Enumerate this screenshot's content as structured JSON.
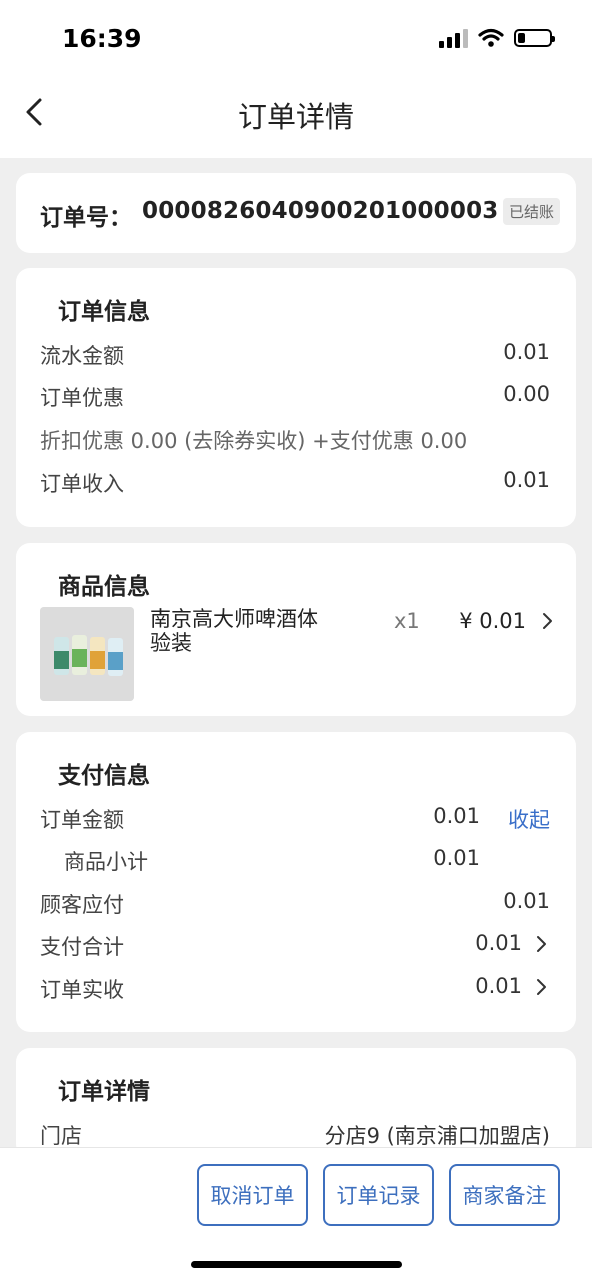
{
  "status_bar": {
    "time": "16:39"
  },
  "nav": {
    "title": "订单详情"
  },
  "order": {
    "label": "订单号：",
    "number": "0000826040900201000003",
    "status": "已结账"
  },
  "order_info": {
    "title": "订单信息",
    "flow_label": "流水金额",
    "flow_value": "0.01",
    "discount_label": "订单优惠",
    "discount_value": "0.00",
    "discount_detail": "折扣优惠 0.00 (去除券实收) +支付优惠 0.00",
    "income_label": "订单收入",
    "income_value": "0.01"
  },
  "product_info": {
    "title": "商品信息",
    "name": "南京高大师啤酒体验装",
    "qty": "x1",
    "price": "¥ 0.01"
  },
  "payment_info": {
    "title": "支付信息",
    "order_amount_label": "订单金额",
    "order_amount_value": "0.01",
    "collapse_label": "收起",
    "subtotal_label": "商品小计",
    "subtotal_value": "0.01",
    "customer_due_label": "顾客应付",
    "customer_due_value": "0.01",
    "pay_total_label": "支付合计",
    "pay_total_value": "0.01",
    "received_label": "订单实收",
    "received_value": "0.01"
  },
  "order_detail": {
    "title": "订单详情",
    "store_label": "门店",
    "store_value": "分店9 (南京浦口加盟店)"
  },
  "actions": {
    "cancel": "取消订单",
    "records": "订单记录",
    "merchant_note": "商家备注"
  },
  "colors": {
    "accent": "#3d6fbe",
    "background": "#efefef",
    "card": "#ffffff"
  }
}
